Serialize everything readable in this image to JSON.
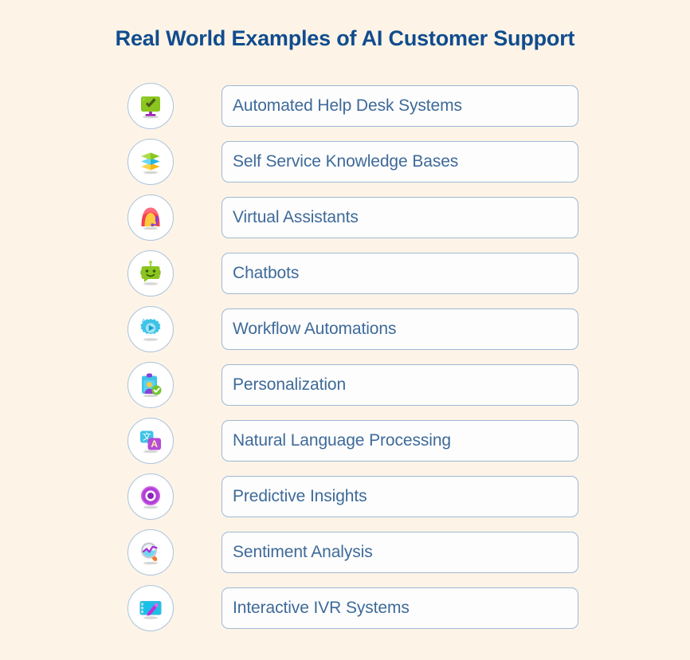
{
  "page": {
    "background_color": "#FDF4E7",
    "title": "Real World Examples of AI Customer Support",
    "title_color": "#114C8E"
  },
  "list": {
    "box_border_color": "#9FB8D4",
    "box_fill_color": "#FDFDFD",
    "label_color": "#3E6A99",
    "circle_border_color": "#A9C3DD",
    "items": [
      {
        "label": "Automated Help Desk Systems",
        "icon": "monitor-check-icon"
      },
      {
        "label": "Self Service Knowledge Bases",
        "icon": "stacked-layers-icon"
      },
      {
        "label": "Virtual Assistants",
        "icon": "headset-agent-icon"
      },
      {
        "label": "Chatbots",
        "icon": "robot-head-icon"
      },
      {
        "label": "Workflow Automations",
        "icon": "gear-play-icon"
      },
      {
        "label": "Personalization",
        "icon": "id-badge-check-icon"
      },
      {
        "label": "Natural Language Processing",
        "icon": "translate-icon"
      },
      {
        "label": "Predictive Insights",
        "icon": "target-circle-icon"
      },
      {
        "label": "Sentiment Analysis",
        "icon": "magnifier-chart-icon"
      },
      {
        "label": "Interactive IVR Systems",
        "icon": "touchscreen-stylus-icon"
      }
    ]
  }
}
